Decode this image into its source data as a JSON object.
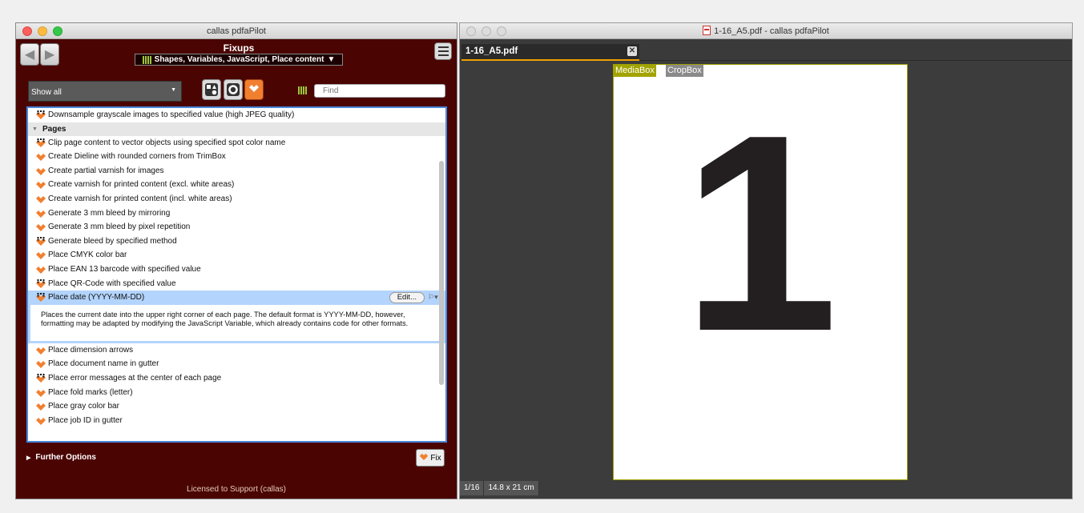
{
  "left_window": {
    "title": "callas pdfaPilot",
    "fixups_title": "Fixups",
    "category_selector": "Shapes, Variables, JavaScript, Place content",
    "filter_select": "Show all",
    "find_placeholder": "Find",
    "top_item": "Downsample grayscale images to specified value (high JPEG quality)",
    "group_label": "Pages",
    "items": [
      {
        "label": "Clip page content to vector objects using specified spot color name",
        "icon": "dotted"
      },
      {
        "label": "Create Dieline with rounded corners from TrimBox",
        "icon": "orange"
      },
      {
        "label": "Create partial varnish for images",
        "icon": "orange"
      },
      {
        "label": "Create varnish for printed content (excl. white areas)",
        "icon": "orange"
      },
      {
        "label": "Create varnish for printed content (incl. white areas)",
        "icon": "orange"
      },
      {
        "label": "Generate 3 mm bleed by mirroring",
        "icon": "orange"
      },
      {
        "label": "Generate 3 mm bleed by pixel repetition",
        "icon": "orange"
      },
      {
        "label": "Generate bleed by specified method",
        "icon": "dotted"
      },
      {
        "label": "Place CMYK color bar",
        "icon": "orange"
      },
      {
        "label": "Place EAN 13 barcode with specified value",
        "icon": "orange"
      },
      {
        "label": "Place QR-Code with specified value",
        "icon": "dotted"
      }
    ],
    "selected_item": {
      "label": "Place date (YYYY-MM-DD)",
      "edit_label": "Edit...",
      "description": "Places the current date into the upper right corner of each page. The default format is YYYY-MM-DD, however, formatting may be adapted by modifying the JavaScript Variable, which already contains code for other formats."
    },
    "items_after": [
      {
        "label": "Place dimension arrows",
        "icon": "orange"
      },
      {
        "label": "Place document name in gutter",
        "icon": "orange"
      },
      {
        "label": "Place error messages at the center of each page",
        "icon": "dotted"
      },
      {
        "label": "Place fold marks (letter)",
        "icon": "orange"
      },
      {
        "label": "Place gray color bar",
        "icon": "orange"
      },
      {
        "label": "Place job ID in gutter",
        "icon": "orange"
      }
    ],
    "further_options": "Further Options",
    "fix_button": "Fix",
    "license": "Licensed to Support (callas)"
  },
  "right_window": {
    "title": "1-16_A5.pdf - callas pdfaPilot",
    "tab_label": "1-16_A5.pdf",
    "mediabox_label": "MediaBox",
    "cropbox_label": "CropBox",
    "page_content": "1",
    "page_indicator": "1/16",
    "page_size": "14.8 x 21 cm"
  },
  "colors": {
    "panel_bg": "#4a0503",
    "accent_orange": "#f08030",
    "selection": "#b3d4fc",
    "mediabox": "#a3a300"
  }
}
